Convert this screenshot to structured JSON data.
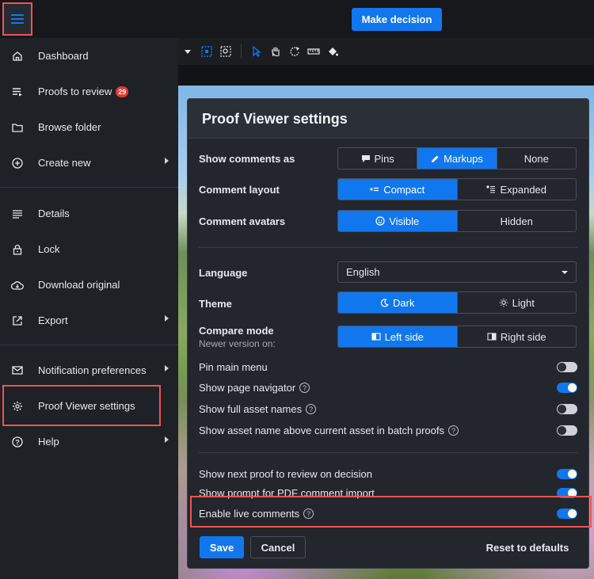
{
  "topbar": {
    "menu_icon": "hamburger-icon",
    "make_decision": "Make decision"
  },
  "colors": {
    "accent": "#1177ef",
    "highlight": "#ef5350",
    "badge": "#e53935"
  },
  "sidebar": {
    "items": [
      {
        "label": "Dashboard",
        "icon": "home-icon"
      },
      {
        "label": "Proofs to review",
        "icon": "list-icon",
        "badge": "29"
      },
      {
        "label": "Browse folder",
        "icon": "folder-icon"
      },
      {
        "label": "Create new",
        "icon": "plus-circle-icon",
        "submenu": true
      },
      {
        "label": "Details",
        "icon": "details-icon"
      },
      {
        "label": "Lock",
        "icon": "lock-icon"
      },
      {
        "label": "Download original",
        "icon": "cloud-download-icon"
      },
      {
        "label": "Export",
        "icon": "export-icon",
        "submenu": true
      },
      {
        "label": "Notification preferences",
        "icon": "mail-icon",
        "submenu": true
      },
      {
        "label": "Proof Viewer settings",
        "icon": "gear-icon"
      },
      {
        "label": "Help",
        "icon": "help-icon",
        "submenu": true
      }
    ]
  },
  "dialog": {
    "title": "Proof Viewer settings",
    "show_comments_as": {
      "label": "Show comments as",
      "options": [
        "Pins",
        "Markups",
        "None"
      ],
      "selected": "Markups"
    },
    "comment_layout": {
      "label": "Comment layout",
      "options": [
        "Compact",
        "Expanded"
      ],
      "selected": "Compact"
    },
    "comment_avatars": {
      "label": "Comment avatars",
      "options": [
        "Visible",
        "Hidden"
      ],
      "selected": "Visible"
    },
    "language": {
      "label": "Language",
      "value": "English"
    },
    "theme": {
      "label": "Theme",
      "options": [
        "Dark",
        "Light"
      ],
      "selected": "Dark"
    },
    "compare_mode": {
      "label": "Compare mode",
      "sublabel": "Newer version on:",
      "options": [
        "Left side",
        "Right side"
      ],
      "selected": "Left side"
    },
    "toggles": [
      {
        "label": "Pin main menu",
        "on": false,
        "help": false
      },
      {
        "label": "Show page navigator",
        "on": true,
        "help": true
      },
      {
        "label": "Show full asset names",
        "on": false,
        "help": true
      },
      {
        "label": "Show asset name above current asset in batch proofs",
        "on": false,
        "help": true
      },
      {
        "label": "Show next proof to review on decision",
        "on": true,
        "help": false
      },
      {
        "label": "Show prompt for PDF comment import",
        "on": true,
        "help": false
      },
      {
        "label": "Enable live comments",
        "on": true,
        "help": true
      }
    ],
    "help_glyph": "?",
    "buttons": {
      "save": "Save",
      "cancel": "Cancel",
      "reset": "Reset to defaults"
    }
  }
}
